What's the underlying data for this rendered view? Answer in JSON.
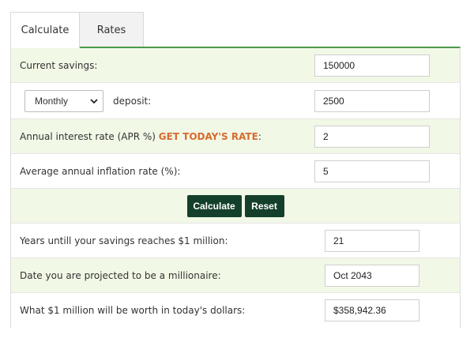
{
  "tabs": [
    {
      "label": "Calculate",
      "active": true
    },
    {
      "label": "Rates",
      "active": false
    }
  ],
  "form": {
    "current_savings": {
      "label": "Current savings:",
      "value": "150000"
    },
    "deposit": {
      "frequency": "Monthly",
      "label": "deposit:",
      "value": "2500"
    },
    "interest_rate": {
      "label_prefix": "Annual interest rate (APR %) ",
      "link": "GET TODAY'S RATE",
      "label_suffix": ":",
      "value": "2"
    },
    "inflation_rate": {
      "label": "Average annual inflation rate (%):",
      "value": "5"
    }
  },
  "buttons": {
    "calculate": "Calculate",
    "reset": "Reset"
  },
  "results": {
    "years": {
      "label": "Years untill your savings reaches $1 million:",
      "value": "21"
    },
    "date": {
      "label": "Date you are projected to be a millionaire:",
      "value": "Oct 2043"
    },
    "worth": {
      "label": "What $1 million will be worth in today's dollars:",
      "value": "$358,942.36"
    }
  },
  "colors": {
    "accent_green": "#4c9a4c",
    "button_bg": "#14402b",
    "row_green": "#f1f8e6",
    "link_orange": "#d86b2e"
  }
}
